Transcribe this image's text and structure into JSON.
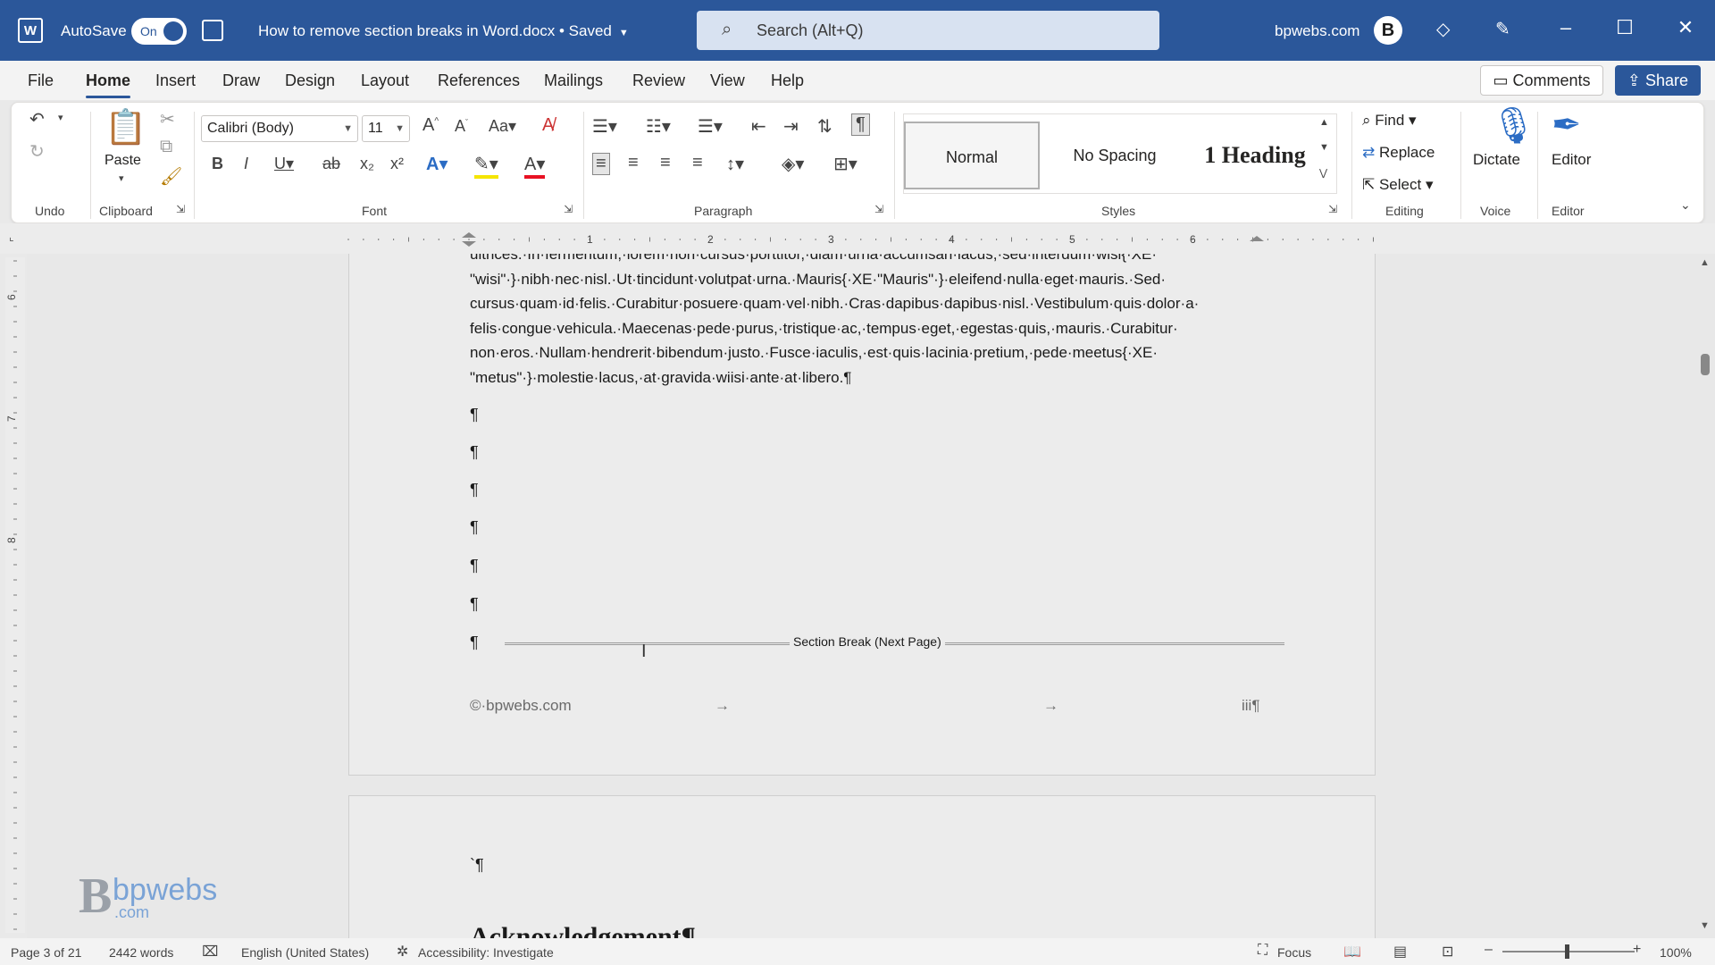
{
  "titlebar": {
    "autosave_label": "AutoSave",
    "autosave_state": "On",
    "doc_title": "How to remove section breaks in Word.docx • Saved",
    "search_placeholder": "Search (Alt+Q)",
    "account": "bpwebs.com",
    "avatar_initial": "B",
    "brand_color": "#2b579a"
  },
  "tabs": [
    "File",
    "Home",
    "Insert",
    "Draw",
    "Design",
    "Layout",
    "References",
    "Mailings",
    "Review",
    "View",
    "Help"
  ],
  "active_tab": "Home",
  "actions": {
    "comments": "Comments",
    "share": "Share"
  },
  "ribbon": {
    "groups": {
      "undo": "Undo",
      "clipboard": "Clipboard",
      "font": "Font",
      "paragraph": "Paragraph",
      "styles": "Styles",
      "editing": "Editing",
      "voice": "Voice",
      "editor": "Editor"
    },
    "paste_label": "Paste",
    "font_name": "Calibri (Body)",
    "font_size": "11",
    "styles": [
      "Normal",
      "No Spacing",
      "Heading 1"
    ],
    "style_heading_num": "1",
    "style_heading_text": "Heading",
    "find": "Find",
    "replace": "Replace",
    "select": "Select",
    "dictate": "Dictate",
    "editor_btn": "Editor"
  },
  "document": {
    "paragraph_lines": [
      "ultrices.·In·fermentum,·lorem·non·cursus·porttitor,·diam·urna·accumsan·lacus,·sed·interdum·wisi{·XE·",
      "\"wisi\"·}·nibh·nec·nisl.·Ut·tincidunt·volutpat·urna.·Mauris{·XE·\"Mauris\"·}·eleifend·nulla·eget·mauris.·Sed·",
      "cursus·quam·id·felis.·Curabitur·posuere·quam·vel·nibh.·Cras·dapibus·dapibus·nisl.·Vestibulum·quis·dolor·a·",
      "felis·congue·vehicula.·Maecenas·pede·purus,·tristique·ac,·tempus·eget,·egestas·quis,·mauris.·Curabitur·",
      "non·eros.·Nullam·hendrerit·bibendum·justo.·Fusce·iaculis,·est·quis·lacinia·pretium,·pede·meetus{·XE·",
      "\"metus\"·}·molestie·lacus,·at·gravida·wiisi·ante·at·libero.¶"
    ],
    "empty_mark": "¶",
    "section_break": "Section Break (Next Page)",
    "footer_left": "©·bpwebs.com",
    "footer_arrow": "→",
    "footer_right": "iii¶",
    "next_page_mark": "`¶",
    "heading": "Acknowledgement¶"
  },
  "watermark": {
    "letter": "B",
    "text": "bpwebs",
    "suffix": ".com"
  },
  "status": {
    "page": "Page 3 of 21",
    "words": "2442 words",
    "language": "English (United States)",
    "accessibility": "Accessibility: Investigate",
    "focus": "Focus",
    "zoom": "100%"
  }
}
